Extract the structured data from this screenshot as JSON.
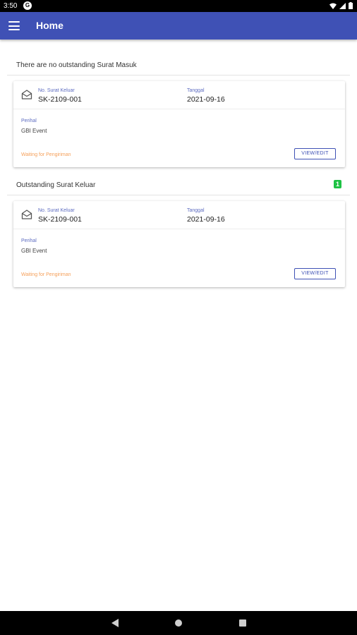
{
  "status_bar": {
    "time": "3:50",
    "app_icon_letter": "G"
  },
  "app_bar": {
    "title": "Home",
    "menu_icon": "hamburger-menu-icon"
  },
  "surat_masuk": {
    "empty_text": "There are no outstanding Surat Masuk"
  },
  "surat_keluar": {
    "title": "Outstanding Surat Keluar",
    "count": "1"
  },
  "cards": [
    {
      "icon": "mail-icon",
      "number_label": "No. Surat Keluar",
      "number": "SK-2109-001",
      "date_label": "Tanggal",
      "date": "2021-09-16",
      "subject_label": "Perihal",
      "subject": "GBI Event",
      "status": "Waiting for Pengiriman",
      "button_label": "VIEW/EDIT"
    },
    {
      "icon": "mail-icon",
      "number_label": "No. Surat Keluar",
      "number": "SK-2109-001",
      "date_label": "Tanggal",
      "date": "2021-09-16",
      "subject_label": "Perihal",
      "subject": "GBI Event",
      "status": "Waiting for Pengiriman",
      "button_label": "VIEW/EDIT"
    }
  ],
  "colors": {
    "primary": "#3f51b5",
    "accent_label": "#5c6bc0",
    "status_orange": "#f5a05a",
    "badge_green": "#1ec244"
  }
}
